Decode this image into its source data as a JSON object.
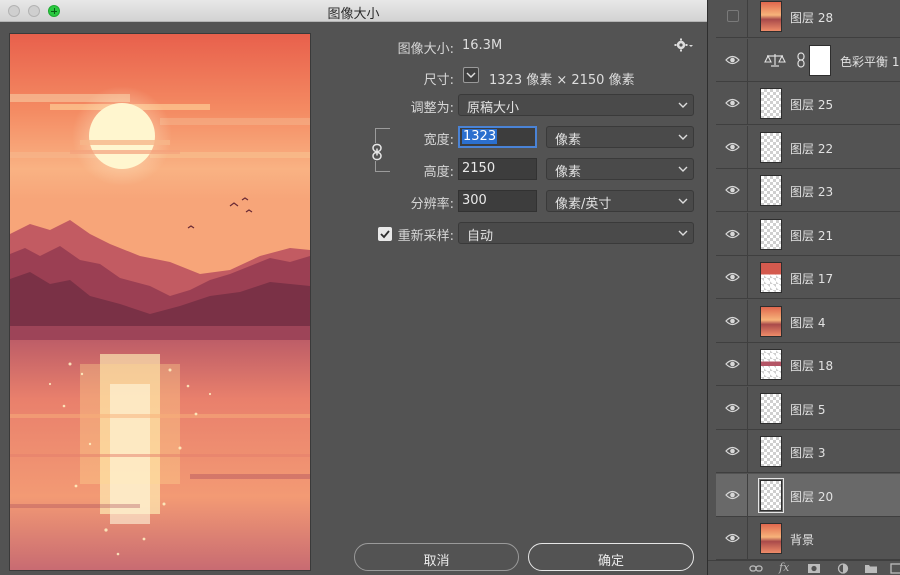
{
  "window": {
    "title": "图像大小"
  },
  "dialog": {
    "image_size_label": "图像大小:",
    "image_size_value": "16.3M",
    "dimensions_label": "尺寸:",
    "dimensions_value": "1323 像素 × 2150 像素",
    "fit_to_label": "调整为:",
    "fit_to_value": "原稿大小",
    "width_label": "宽度:",
    "width_value": "1323",
    "width_unit": "像素",
    "height_label": "高度:",
    "height_value": "2150",
    "height_unit": "像素",
    "resolution_label": "分辨率:",
    "resolution_value": "300",
    "resolution_unit": "像素/英寸",
    "resample_label": "重新采样:",
    "resample_checked": true,
    "resample_value": "自动",
    "cancel_label": "取消",
    "ok_label": "确定"
  },
  "layers": [
    {
      "name": "图层 28",
      "visible": false,
      "thumb": "image"
    },
    {
      "name": "色彩平衡 1",
      "visible": true,
      "thumb": "adjustment",
      "icon": "balance-scale-icon"
    },
    {
      "name": "图层 25",
      "visible": true,
      "thumb": "transparent"
    },
    {
      "name": "图层 22",
      "visible": true,
      "thumb": "transparent"
    },
    {
      "name": "图层 23",
      "visible": true,
      "thumb": "transparent"
    },
    {
      "name": "图层 21",
      "visible": true,
      "thumb": "transparent"
    },
    {
      "name": "图层 17",
      "visible": true,
      "thumb": "strip-top"
    },
    {
      "name": "图层 4",
      "visible": true,
      "thumb": "image"
    },
    {
      "name": "图层 18",
      "visible": true,
      "thumb": "strip-mid"
    },
    {
      "name": "图层 5",
      "visible": true,
      "thumb": "transparent"
    },
    {
      "name": "图层 3",
      "visible": true,
      "thumb": "transparent"
    },
    {
      "name": "图层 20",
      "visible": true,
      "thumb": "transparent",
      "selected": true
    },
    {
      "name": "背景",
      "visible": true,
      "thumb": "image"
    }
  ],
  "footer_icons": [
    "link-layers-icon",
    "fx-icon",
    "add-mask-icon",
    "adjustment-layer-icon",
    "group-folder-icon",
    "new-layer-icon"
  ],
  "colors": {
    "accent": "#2b6fce",
    "panel": "#535353",
    "dialog": "#535353",
    "focus_ring": "#4a83d6"
  }
}
